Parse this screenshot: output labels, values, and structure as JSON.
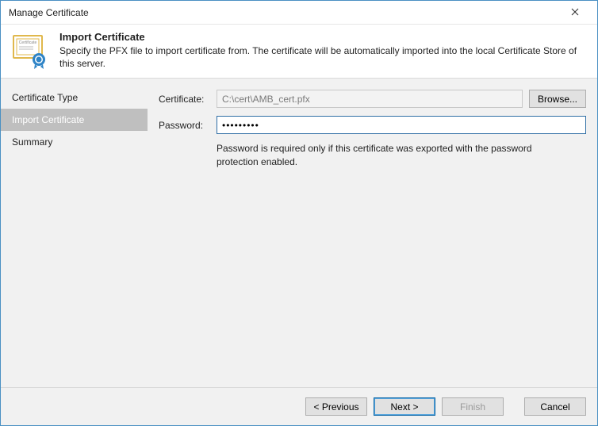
{
  "window": {
    "title": "Manage Certificate"
  },
  "header": {
    "title": "Import Certificate",
    "subtitle": "Specify the PFX file to import certificate from. The certificate will be automatically imported into the local Certificate Store of this server."
  },
  "sidebar": {
    "items": [
      {
        "label": "Certificate Type",
        "active": false
      },
      {
        "label": "Import Certificate",
        "active": true
      },
      {
        "label": "Summary",
        "active": false
      }
    ]
  },
  "form": {
    "certificate_label": "Certificate:",
    "certificate_value": "C:\\cert\\AMB_cert.pfx",
    "browse_label": "Browse...",
    "password_label": "Password:",
    "password_value": "•••••••••",
    "hint": "Password is required only if this certificate was exported with the password protection enabled."
  },
  "footer": {
    "previous": "< Previous",
    "next": "Next >",
    "finish": "Finish",
    "cancel": "Cancel"
  }
}
